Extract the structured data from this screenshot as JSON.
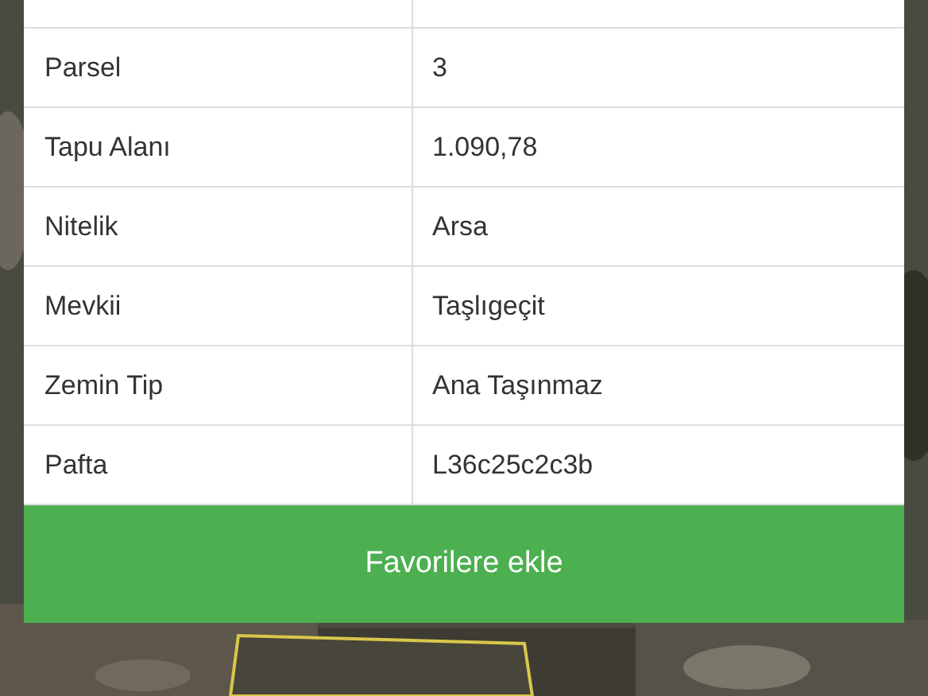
{
  "table": {
    "rows": [
      {
        "label": "Parsel",
        "value": "3"
      },
      {
        "label": "Tapu Alanı",
        "value": "1.090,78"
      },
      {
        "label": "Nitelik",
        "value": "Arsa"
      },
      {
        "label": "Mevkii",
        "value": "Taşlıgeçit"
      },
      {
        "label": "Zemin Tip",
        "value": "Ana Taşınmaz"
      },
      {
        "label": "Pafta",
        "value": "L36c25c2c3b"
      }
    ]
  },
  "button": {
    "label": "Favorilere ekle"
  }
}
